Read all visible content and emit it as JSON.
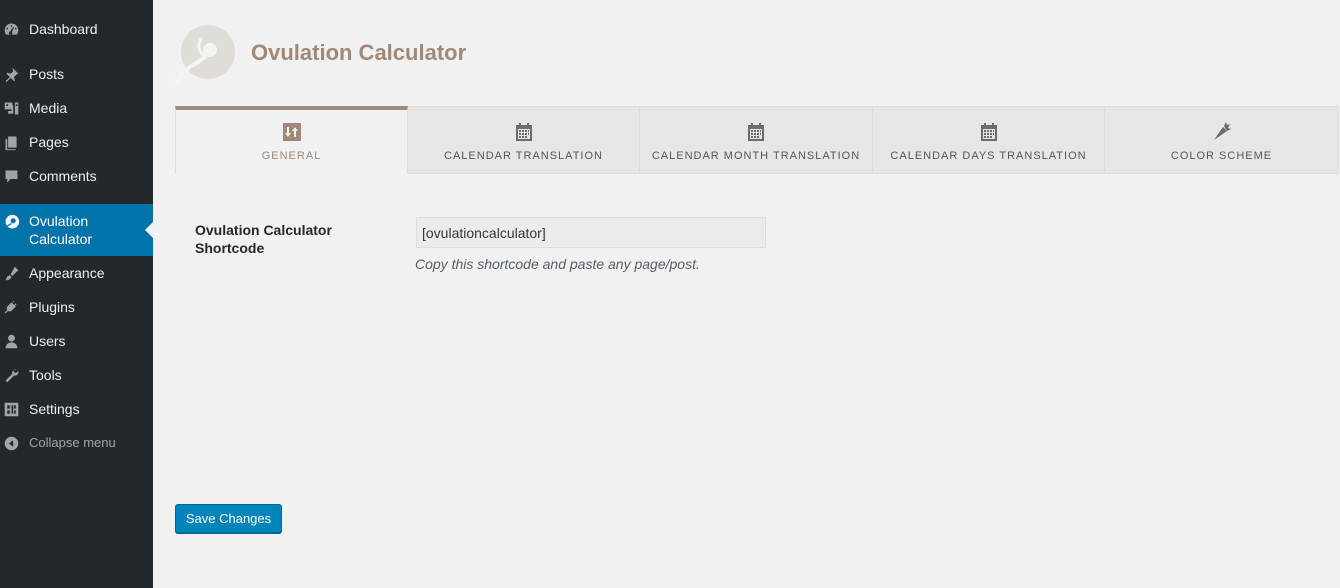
{
  "colors": {
    "sidebar_bg": "#23282d",
    "active_menu_bg": "#0073aa",
    "accent": "#a08978",
    "button_bg": "#0085ba"
  },
  "sidebar": {
    "items": [
      {
        "label": "Dashboard",
        "icon": "dashboard-icon"
      },
      {
        "label": "Posts",
        "icon": "pushpin-icon"
      },
      {
        "label": "Media",
        "icon": "media-icon"
      },
      {
        "label": "Pages",
        "icon": "pages-icon"
      },
      {
        "label": "Comments",
        "icon": "comment-icon"
      },
      {
        "label": "Ovulation Calculator",
        "icon": "ovulation-icon",
        "active": true
      },
      {
        "label": "Appearance",
        "icon": "paintbrush-icon"
      },
      {
        "label": "Plugins",
        "icon": "plug-icon"
      },
      {
        "label": "Users",
        "icon": "user-icon"
      },
      {
        "label": "Tools",
        "icon": "wrench-icon"
      },
      {
        "label": "Settings",
        "icon": "settings-icon"
      }
    ],
    "collapse_label": "Collapse menu"
  },
  "header": {
    "title": "Ovulation Calculator",
    "logo_icon": "ovulation-logo-icon"
  },
  "tabs": [
    {
      "label": "GENERAL",
      "icon": "sort-icon",
      "active": true
    },
    {
      "label": "CALENDAR TRANSLATION",
      "icon": "calendar-icon"
    },
    {
      "label": "CALENDAR MONTH TRANSLATION",
      "icon": "calendar-icon"
    },
    {
      "label": "CALENDAR DAYS TRANSLATION",
      "icon": "calendar-icon"
    },
    {
      "label": "COLOR SCHEME",
      "icon": "carrot-icon"
    }
  ],
  "form": {
    "shortcode_label": "Ovulation Calculator Shortcode",
    "shortcode_value": "[ovulationcalculator]",
    "shortcode_description": "Copy this shortcode and paste any page/post."
  },
  "save_label": "Save Changes"
}
